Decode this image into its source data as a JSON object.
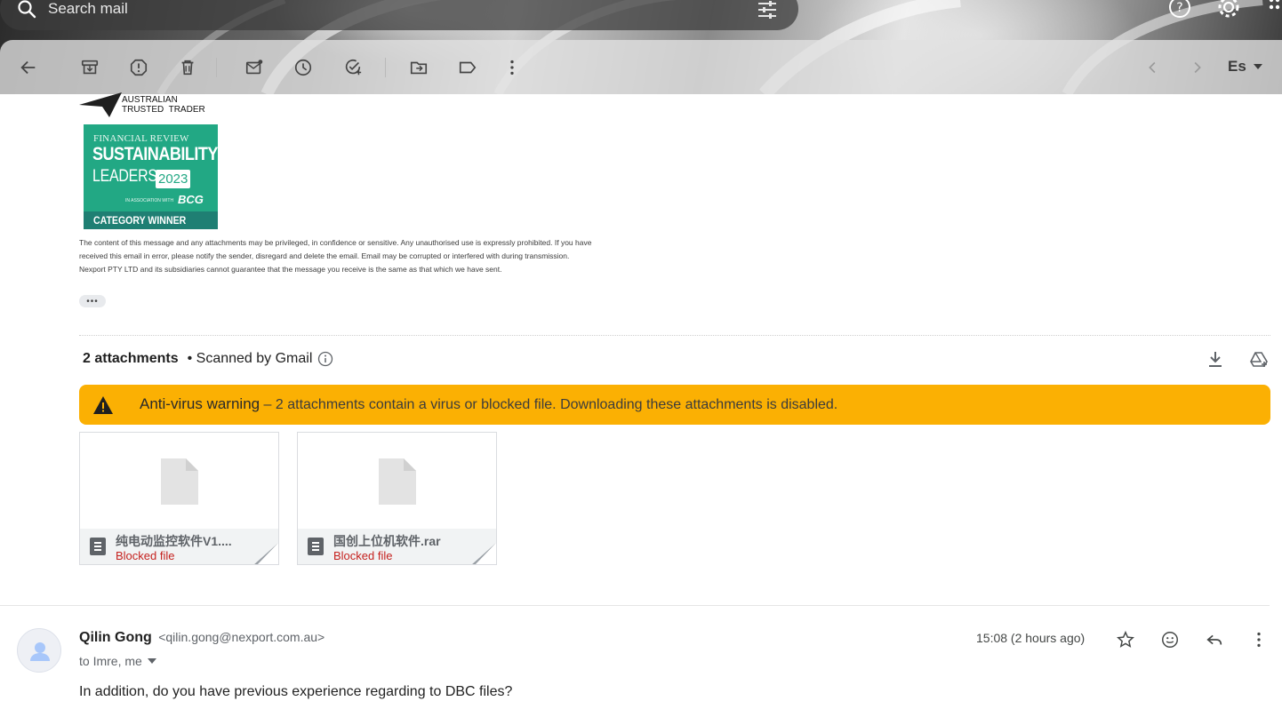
{
  "search": {
    "placeholder": "Search mail",
    "search_icon": "search-icon",
    "filter_icon": "tune-icon"
  },
  "header_actions": {
    "help_icon": "help-icon",
    "settings_icon": "gear-icon",
    "apps_icon": "apps-grid-icon"
  },
  "toolbar": {
    "items": [
      {
        "name": "back",
        "icon": "arrow-back-icon"
      },
      {
        "name": "archive",
        "icon": "archive-icon"
      },
      {
        "name": "report-spam",
        "icon": "report-icon"
      },
      {
        "name": "delete",
        "icon": "trash-icon"
      },
      {
        "name": "mark-unread",
        "icon": "mark-unread-icon"
      },
      {
        "name": "snooze",
        "icon": "clock-icon"
      },
      {
        "name": "add-to-tasks",
        "icon": "add-task-icon"
      },
      {
        "name": "move-to",
        "icon": "move-to-icon"
      },
      {
        "name": "labels",
        "icon": "label-icon"
      },
      {
        "name": "more",
        "icon": "more-vert-icon"
      }
    ],
    "prev_icon": "chevron-left-icon",
    "next_icon": "chevron-right-icon",
    "input_language": "Es"
  },
  "signature": {
    "trusted_trader": "AUSTRALIAN\nTRUSTED TRADER",
    "trusted_trader_lines": [
      "AUSTRALIAN",
      "TRUSTED  TRADER"
    ],
    "badge": {
      "line1": "FINANCIAL REVIEW",
      "line2": "SUSTAINABILITY",
      "line3": "LEADERS",
      "year": "2023",
      "assoc": "IN ASSOCIATION WITH",
      "partner": "BCG",
      "footer": "CATEGORY WINNER"
    },
    "disclaimer": "The content of this message and any attachments may be privileged, in confidence or sensitive. Any unauthorised use is expressly prohibited. If you have received this email in error, please notify the sender, disregard and delete the email. Email may be corrupted or interfered with during transmission. Nexport PTY LTD and its subsidiaries cannot guarantee that the message you receive is the same as that which we have sent.",
    "disclaimer_lines": [
      "The content of this message and any attachments may be privileged, in confidence or sensitive. Any unauthorised use is expressly prohibited. If you have",
      "received this email in error, please notify the sender, disregard and delete the email. Email may be corrupted or interfered with during transmission.",
      "Nexport PTY LTD and its subsidiaries cannot guarantee that the message you receive is the same as that which we have sent."
    ],
    "expand_label": "•••"
  },
  "attachments": {
    "count_label": "2 attachments",
    "scanned_label": "• Scanned by Gmail",
    "warning_title": "Anti-virus warning",
    "warning_text": " – 2 attachments contain a virus or blocked file. Downloading these attachments is disabled.",
    "files": [
      {
        "name": "纯电动监控软件V1....",
        "status": "Blocked file"
      },
      {
        "name": "国创上位机软件.rar",
        "status": "Blocked file"
      }
    ],
    "colors": {
      "warning_bg": "#fbb003",
      "blocked_text": "#c5221f"
    }
  },
  "message": {
    "sender_name": "Qilin Gong",
    "sender_email": "<qilin.gong@nexport.com.au>",
    "recipients": "to Imre, me",
    "timestamp": "15:08 (2 hours ago)",
    "body": "In addition, do you have previous experience regarding to DBC files?",
    "action_icons": [
      "star-icon",
      "emoji-icon",
      "reply-icon",
      "more-vert-icon"
    ]
  }
}
